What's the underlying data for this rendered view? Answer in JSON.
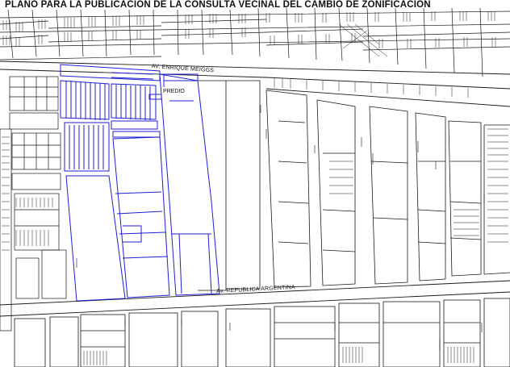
{
  "title": "PLANO PARA LA PUBLICACIÓN DE LA CONSULTA VECINAL DEL CAMBIO DE ZONIFICACIÓN",
  "labels": {
    "street_top": "AV. ENRIQUE MEIGGS",
    "street_bottom": "Av. REPUBLICA ARGENTINA",
    "predio": "PREDIO"
  },
  "colors": {
    "line": "#1a1a1a",
    "highlight": "#1f1fd6",
    "background": "#ffffff"
  }
}
